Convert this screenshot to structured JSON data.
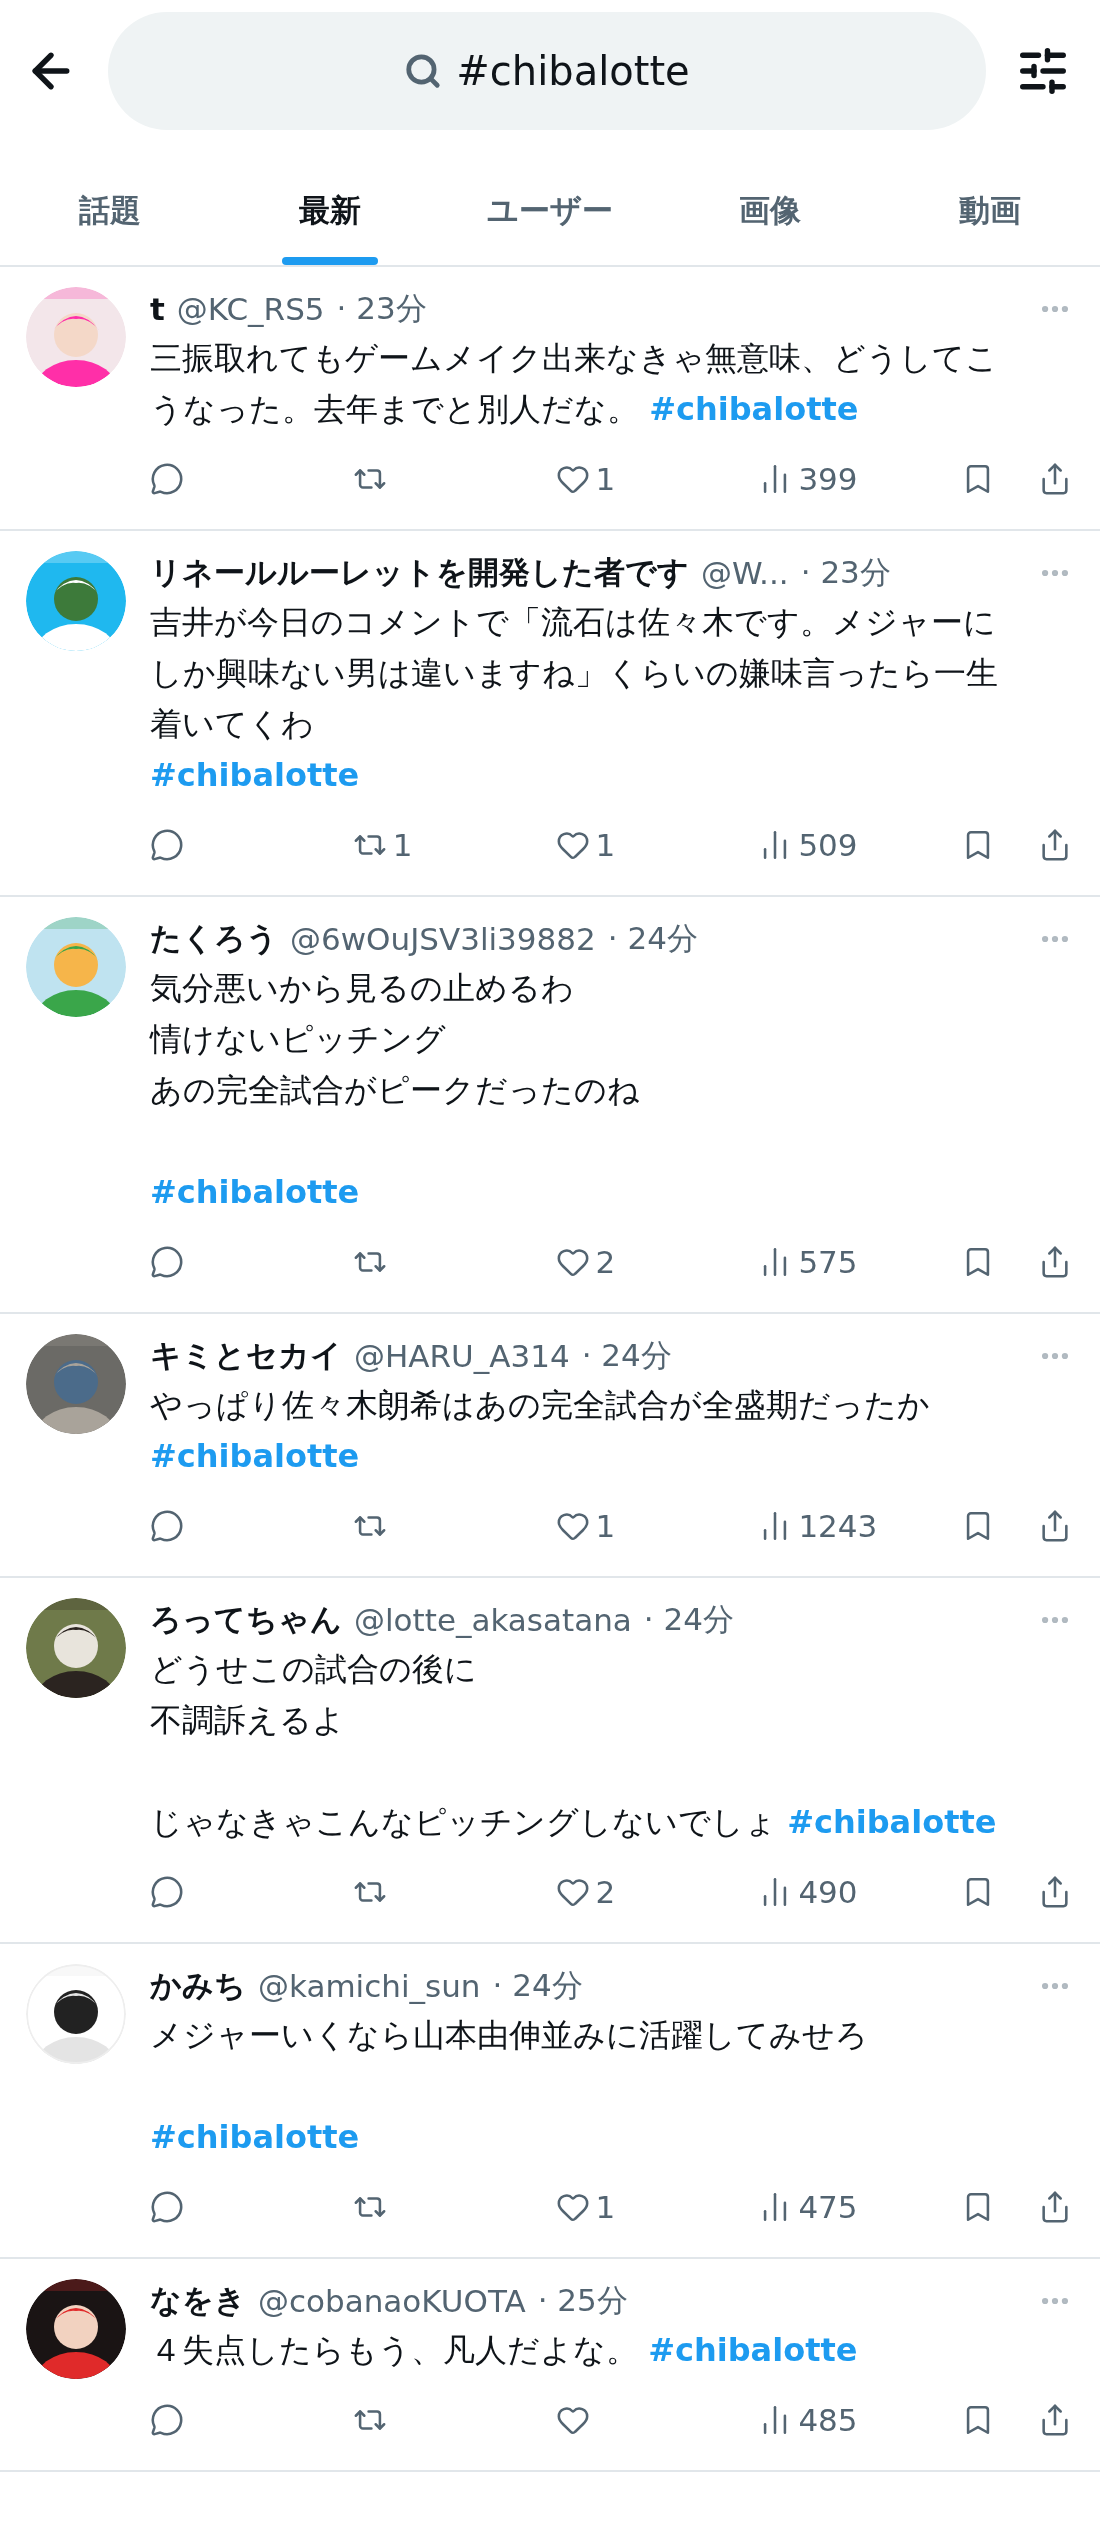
{
  "header": {
    "search_value": "#chibalotte"
  },
  "tabs": [
    {
      "label": "話題",
      "selected": false
    },
    {
      "label": "最新",
      "selected": true
    },
    {
      "label": "ユーザー",
      "selected": false
    },
    {
      "label": "画像",
      "selected": false
    },
    {
      "label": "動画",
      "selected": false
    }
  ],
  "tweets": [
    {
      "name": "t",
      "handle": "@KC_RS5",
      "time": "· 23分",
      "paragraphs": [
        [
          {
            "text": "三振取れてもゲームメイク出来なきゃ無意味、どうしてこうなった。去年までと別人だな。",
            "hashtag": "#chibalotte"
          }
        ]
      ],
      "likes": "1",
      "views": "399"
    },
    {
      "name": "リネールルーレットを開発した者です",
      "handle": "@W...",
      "time": "· 23分",
      "paragraphs": [
        [
          {
            "text": "吉井が今日のコメントで「流石は佐々木です。メジャーにしか興味ない男は違いますね」くらいの嫌味言ったら一生着いてくわ"
          },
          {
            "hashtag": "#chibalotte"
          }
        ]
      ],
      "retweets": "1",
      "likes": "1",
      "views": "509"
    },
    {
      "name": "たくろう",
      "handle": "@6wOuJSV3li39882",
      "time": "· 24分",
      "paragraphs": [
        [
          {
            "text": "気分悪いから見るの止めるわ"
          },
          {
            "text": "情けないピッチング"
          },
          {
            "text": "あの完全試合がピークだったのね"
          }
        ],
        [
          {
            "hashtag": "#chibalotte"
          }
        ]
      ],
      "likes": "2",
      "views": "575"
    },
    {
      "name": "キミとセカイ",
      "handle": "@HARU_A314",
      "time": "· 24分",
      "paragraphs": [
        [
          {
            "text": "やっぱり佐々木朗希はあの完全試合が全盛期だったか"
          },
          {
            "hashtag": "#chibalotte"
          }
        ]
      ],
      "likes": "1",
      "views": "1243"
    },
    {
      "name": "ろってちゃん",
      "handle": "@lotte_akasatana",
      "time": "· 24分",
      "paragraphs": [
        [
          {
            "text": "どうせこの試合の後に"
          },
          {
            "text": "不調訴えるよ"
          }
        ],
        [
          {
            "text": "じゃなきゃこんなピッチングしないでしょ",
            "hashtag": "#chibalotte"
          }
        ]
      ],
      "likes": "2",
      "views": "490"
    },
    {
      "name": "かみち",
      "handle": "@kamichi_sun",
      "time": "· 24分",
      "paragraphs": [
        [
          {
            "text": "メジャーいくなら山本由伸並みに活躍してみせろ"
          }
        ],
        [
          {
            "hashtag": "#chibalotte"
          }
        ]
      ],
      "likes": "1",
      "views": "475"
    },
    {
      "name": "なをき",
      "handle": "@cobanaoKUOTA",
      "time": "· 25分",
      "paragraphs": [
        [
          {
            "text": "４失点したらもう、凡人だよな。",
            "hashtag": "#chibalotte"
          }
        ]
      ],
      "views": "485"
    }
  ]
}
